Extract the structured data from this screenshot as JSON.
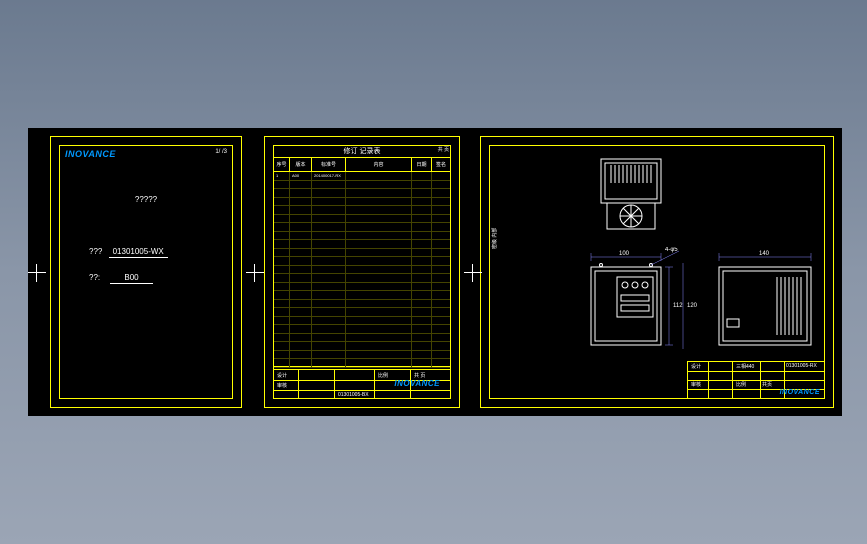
{
  "sheet1": {
    "brand": "INOVANCE",
    "top_right": "1/ /3",
    "title": "?????",
    "field1_label": "???",
    "field1_value": "01301005-WX",
    "field2_label": "??:",
    "field2_value": "B00"
  },
  "sheet2": {
    "title": "修订 记录表",
    "top_right": "共  页",
    "headers": [
      "序号",
      "版本",
      "标准号",
      "内容",
      "日期",
      "签名"
    ],
    "row1": {
      "c1": "1",
      "c2": "A00",
      "c3": "201400017-RX",
      "c4": "",
      "c5": "",
      "c6": ""
    },
    "row_count": 23,
    "titleblock": {
      "l1a": "设计",
      "l1b": "",
      "l1c": "比例",
      "l1d": "共  页",
      "l2a": "审核",
      "l2b": "",
      "l2c": "01301005-BX",
      "brand": "INOVANCE"
    }
  },
  "sheet3": {
    "side_label": "密级  内部",
    "views": {
      "top": {
        "label": ""
      },
      "front": {
        "dim_w": "100",
        "dim_h1": "112",
        "dim_h2": "120",
        "note": "4-φ5"
      },
      "side": {
        "dim_w": "140"
      }
    },
    "titleblock": {
      "r1a": "设计",
      "r1b": "三相440",
      "r2a": "",
      "r2b": "01301005-RX",
      "r3a": "审核",
      "r3b": "",
      "brand": "INOVANCE",
      "scale": "比例",
      "sheet": "共页"
    }
  }
}
